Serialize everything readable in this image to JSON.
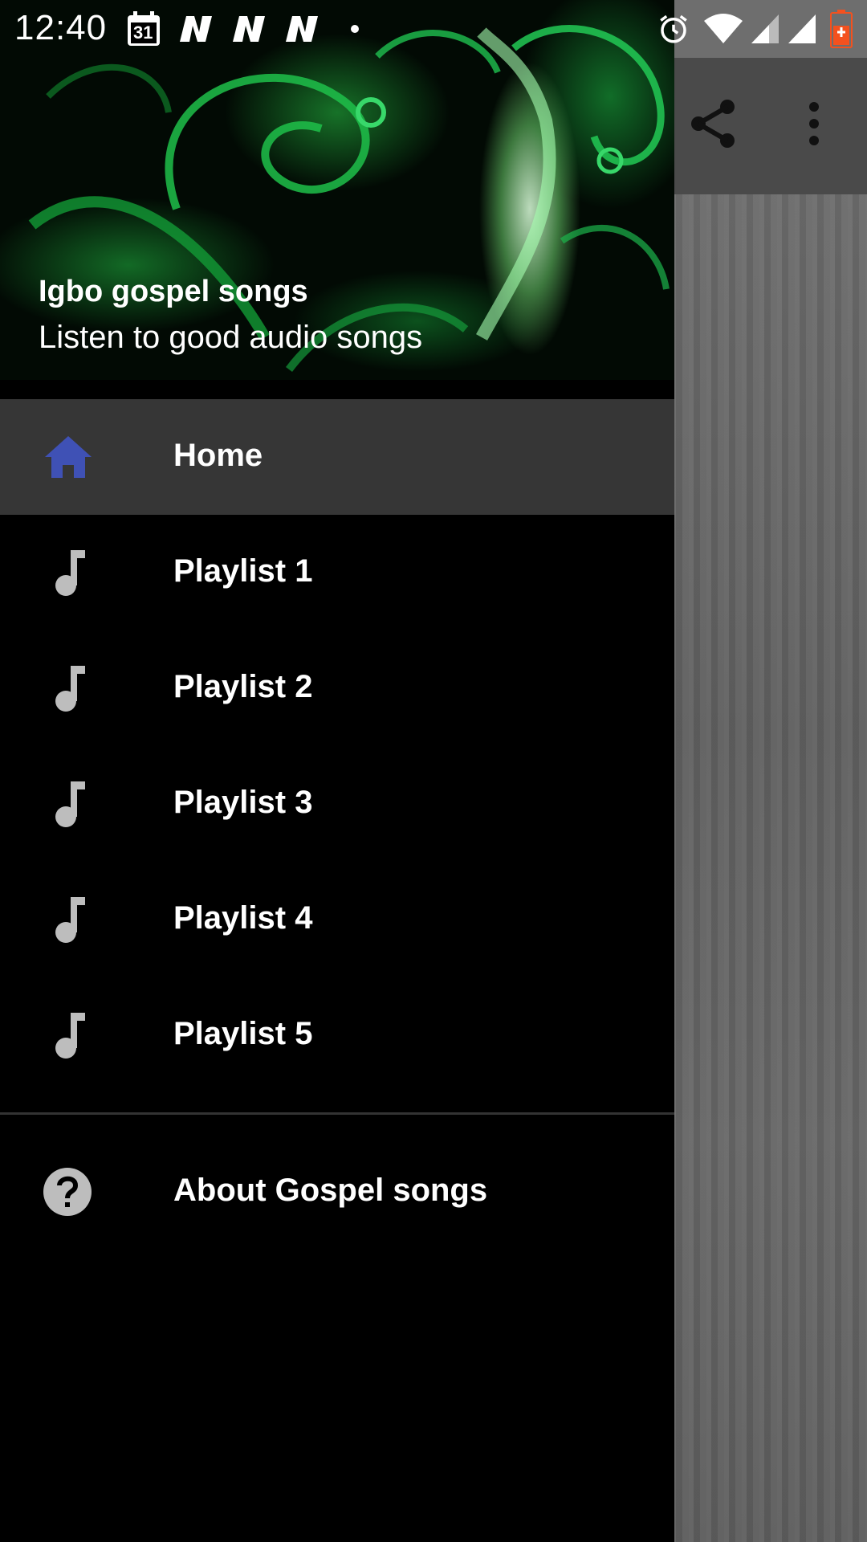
{
  "status_bar": {
    "time": "12:40",
    "calendar_day": "31",
    "notification_icons": [
      "calendar-icon",
      "n-app-icon",
      "n-app-icon",
      "n-app-icon",
      "dot-icon"
    ],
    "system_icons": [
      "alarm-icon",
      "wifi-icon",
      "signal-icon",
      "signal-icon",
      "battery-icon"
    ]
  },
  "app_bar": {
    "icons": [
      "share-icon",
      "more-vert-icon"
    ]
  },
  "drawer": {
    "header": {
      "title": "Igbo gospel songs",
      "subtitle": "Listen to good audio songs"
    },
    "items": [
      {
        "label": "Home",
        "icon": "home-icon",
        "selected": true
      },
      {
        "label": "Playlist 1",
        "icon": "music-note-icon"
      },
      {
        "label": "Playlist 2",
        "icon": "music-note-icon"
      },
      {
        "label": "Playlist 3",
        "icon": "music-note-icon"
      },
      {
        "label": "Playlist 4",
        "icon": "music-note-icon"
      },
      {
        "label": "Playlist 5",
        "icon": "music-note-icon"
      }
    ],
    "footer_items": [
      {
        "label": "About Gospel songs",
        "icon": "help-icon"
      }
    ]
  },
  "colors": {
    "accent": "#3f51b5",
    "selected_bg": "#363636",
    "icon_grey": "#bdbdbd",
    "battery": "#f4511e"
  }
}
